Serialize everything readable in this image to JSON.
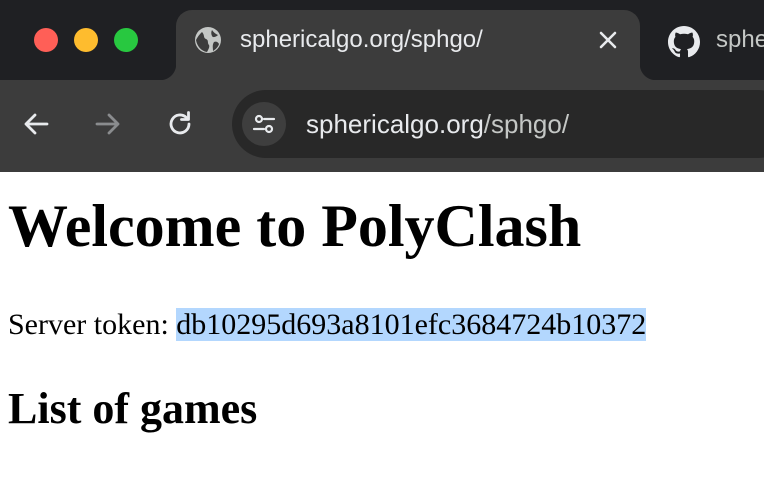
{
  "browser": {
    "active_tab": {
      "title": "sphericalgo.org/sphgo/",
      "favicon": "globe-icon"
    },
    "inactive_tab": {
      "title": "sphe",
      "favicon": "github-icon"
    },
    "address_bar": {
      "domain": "sphericalgo.org",
      "path": "/sphgo/"
    },
    "toolbar_icons": [
      "back-arrow-icon",
      "forward-arrow-icon",
      "reload-icon",
      "site-settings-icon"
    ]
  },
  "page": {
    "heading": "Welcome to PolyClash",
    "token_label": "Server token: ",
    "token_value": "db10295d693a8101efc3684724b10372",
    "games_heading": "List of games"
  },
  "colors": {
    "tab_bar": "#1f2023",
    "toolbar": "#3c3c3c",
    "selection_highlight": "#b3d7fe",
    "close_red": "#ff5f57",
    "minimize_yellow": "#febc2e",
    "zoom_green": "#28c840"
  }
}
